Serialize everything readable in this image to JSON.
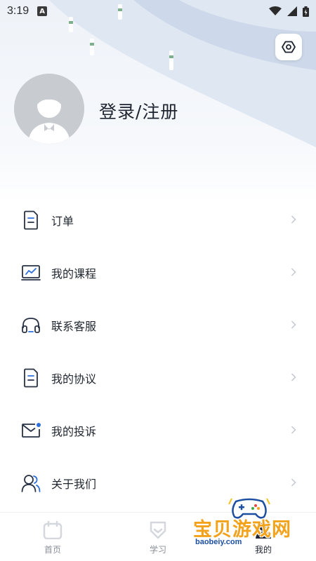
{
  "status_bar": {
    "time": "3:19",
    "badge": "A"
  },
  "profile": {
    "login_label": "登录/注册"
  },
  "menu": {
    "items": [
      {
        "label": "订单",
        "icon": "document-icon"
      },
      {
        "label": "我的课程",
        "icon": "chart-monitor-icon"
      },
      {
        "label": "联系客服",
        "icon": "headset-icon"
      },
      {
        "label": "我的协议",
        "icon": "document-icon"
      },
      {
        "label": "我的投诉",
        "icon": "mail-icon"
      },
      {
        "label": "关于我们",
        "icon": "users-icon"
      }
    ]
  },
  "tabbar": {
    "tabs": [
      {
        "label": "首页",
        "icon": "calendar-icon"
      },
      {
        "label": "学习",
        "icon": "shield-icon"
      },
      {
        "label": "我的",
        "icon": "user-icon",
        "active": true
      }
    ]
  },
  "watermark": {
    "title": "宝贝游戏网",
    "url": "baobeiy.com"
  },
  "colors": {
    "accent": "#2b6fde",
    "text": "#1f2633",
    "icon": "#283244",
    "arrow": "#c4c8cf"
  }
}
